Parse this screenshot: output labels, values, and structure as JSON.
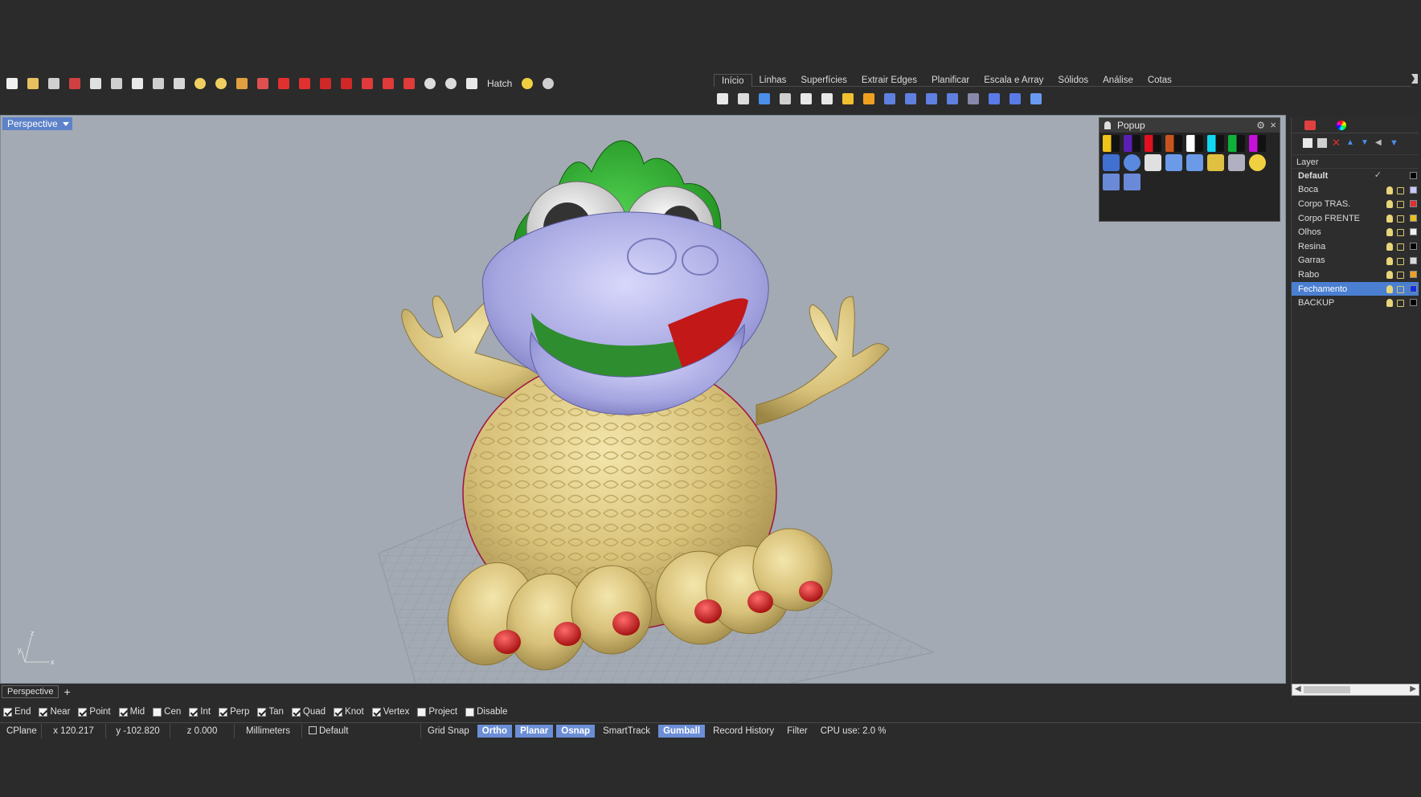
{
  "toolbar": {
    "icons": [
      "new-file-icon",
      "open-file-icon",
      "save-icon",
      "save-as-icon",
      "print-icon",
      "undo-icon",
      "pan-hand-icon",
      "rotate-view-icon",
      "zoom-icon",
      "light-icon",
      "lights-icon",
      "named-view-icon",
      "cplane-icon",
      "red-object-icon",
      "red-object-icon",
      "red-shape-icon",
      "red-shape-icon",
      "red-car-icon",
      "red-car-icon",
      "red-car-icon",
      "render-sphere-icon",
      "render-sphere-icon",
      "select-arrow-icon"
    ],
    "hatch_label": "Hatch",
    "extra_icons": [
      "sun-icon",
      "help-icon"
    ]
  },
  "tabs": [
    "Início",
    "Linhas",
    "Superfícies",
    "Extrair Edges",
    "Planificar",
    "Escala e Array",
    "Sólidos",
    "Análise",
    "Cotas"
  ],
  "active_tab": 0,
  "tab_tools": [
    "point-icon",
    "grid-points-icon",
    "line-icon",
    "mirror-icon",
    "offset-icon",
    "trim-icon",
    "explode-icon",
    "fillet-icon",
    "boolean-icon",
    "boolean-icon",
    "boolean-icon",
    "boolean-icon",
    "rotate-icon",
    "box-icon",
    "box-icon",
    "text-icon"
  ],
  "viewport": {
    "label": "Perspective",
    "axis_x": "x",
    "axis_y": "y",
    "axis_z": "z"
  },
  "popup": {
    "title": "Popup",
    "row1": [
      {
        "color": "#f0c419"
      },
      {
        "color": "#5a1fb5"
      },
      {
        "color": "#e01020"
      },
      {
        "color": "#c8551e"
      },
      {
        "color": "#ffffff"
      },
      {
        "color": "#12d7f0"
      },
      {
        "color": "#10b13a"
      },
      {
        "color": "#c410d9"
      }
    ],
    "row2_icons": [
      "mesh-grid-icon",
      "sphere-grid-icon",
      "gumball-icon",
      "link-icon",
      "link-icon",
      "render-icon",
      "shade-icon",
      "light-bulb-icon"
    ],
    "row3_icons": [
      "shield-icon",
      "hatch-icon"
    ]
  },
  "layers": {
    "header": "Layer",
    "rows": [
      {
        "name": "Default",
        "color": "#000000",
        "bold": true,
        "current": true,
        "selected": false
      },
      {
        "name": "Boca",
        "color": "#c6c8ff",
        "bold": false,
        "current": false,
        "selected": false
      },
      {
        "name": "Corpo TRAS.",
        "color": "#e03030",
        "bold": false,
        "current": false,
        "selected": false
      },
      {
        "name": "Corpo FRENTE",
        "color": "#e8c020",
        "bold": false,
        "current": false,
        "selected": false
      },
      {
        "name": "Olhos",
        "color": "#f0f0f0",
        "bold": false,
        "current": false,
        "selected": false
      },
      {
        "name": "Resina",
        "color": "#000000",
        "bold": false,
        "current": false,
        "selected": false
      },
      {
        "name": "Garras",
        "color": "#d8d8d8",
        "bold": false,
        "current": false,
        "selected": false
      },
      {
        "name": "Rabo",
        "color": "#f0a020",
        "bold": false,
        "current": false,
        "selected": false
      },
      {
        "name": "Fechamento",
        "color": "#1030e0",
        "bold": false,
        "current": false,
        "selected": true
      },
      {
        "name": "BACKUP",
        "color": "#000000",
        "bold": false,
        "current": false,
        "selected": false
      }
    ]
  },
  "view_tab": "Perspective",
  "osnaps": [
    {
      "label": "End",
      "checked": true
    },
    {
      "label": "Near",
      "checked": true
    },
    {
      "label": "Point",
      "checked": true
    },
    {
      "label": "Mid",
      "checked": true
    },
    {
      "label": "Cen",
      "checked": false
    },
    {
      "label": "Int",
      "checked": true
    },
    {
      "label": "Perp",
      "checked": true
    },
    {
      "label": "Tan",
      "checked": true
    },
    {
      "label": "Quad",
      "checked": true
    },
    {
      "label": "Knot",
      "checked": true
    },
    {
      "label": "Vertex",
      "checked": true
    },
    {
      "label": "Project",
      "checked": false
    },
    {
      "label": "Disable",
      "checked": false
    }
  ],
  "status": {
    "cplane": "CPlane",
    "x": "x 120.217",
    "y": "y -102.820",
    "z": "z 0.000",
    "units": "Millimeters",
    "layer": "Default",
    "grid_snap": "Grid Snap",
    "ortho": "Ortho",
    "planar": "Planar",
    "osnap": "Osnap",
    "smarttrack": "SmartTrack",
    "gumball": "Gumball",
    "record_history": "Record History",
    "filter": "Filter",
    "cpu": "CPU use: 2.0 %"
  }
}
